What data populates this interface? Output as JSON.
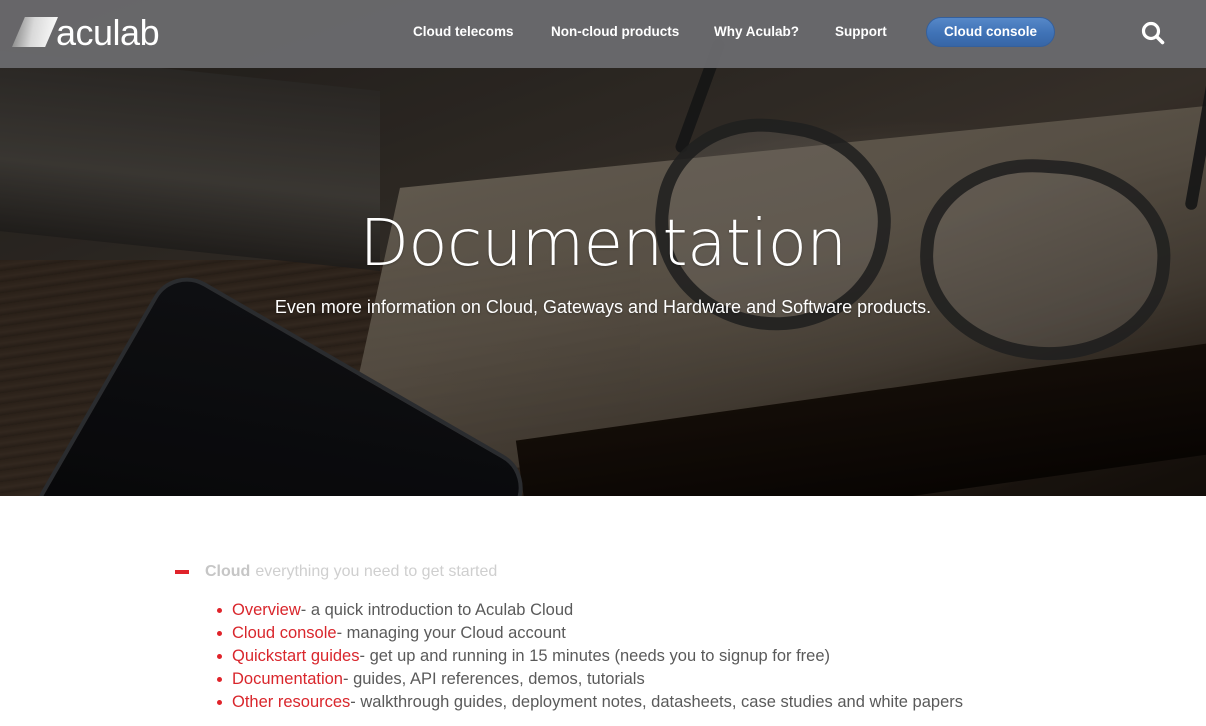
{
  "header": {
    "logo_text": "aculab",
    "nav": [
      {
        "label": "Cloud telecoms"
      },
      {
        "label": "Non-cloud products"
      },
      {
        "label": "Why Aculab?"
      },
      {
        "label": "Support"
      }
    ],
    "console_button": "Cloud console",
    "search_icon": "search-icon"
  },
  "hero": {
    "title": "Documentation",
    "subtitle": "Even more information on Cloud, Gateways and Hardware and Software products."
  },
  "section": {
    "toggle_icon": "minus-icon",
    "title": "Cloud",
    "description": "everything you need to get started",
    "items": [
      {
        "link": "Overview",
        "desc": " - a quick introduction to Aculab Cloud"
      },
      {
        "link": "Cloud console",
        "desc": " - managing your Cloud account"
      },
      {
        "link": "Quickstart guides",
        "desc": " - get up and running in 15 minutes (needs you to signup for free)"
      },
      {
        "link": "Documentation",
        "desc": " - guides, API references, demos, tutorials"
      },
      {
        "link": "Other resources",
        "desc": " - walkthrough guides, deployment notes, datasheets, case studies and white papers"
      }
    ]
  },
  "colors": {
    "header_bg": "#69696c",
    "accent_red": "#d9262c",
    "button_blue": "#3f72b6",
    "body_text": "#5a5a5a",
    "muted_text": "#c6c6c6"
  }
}
